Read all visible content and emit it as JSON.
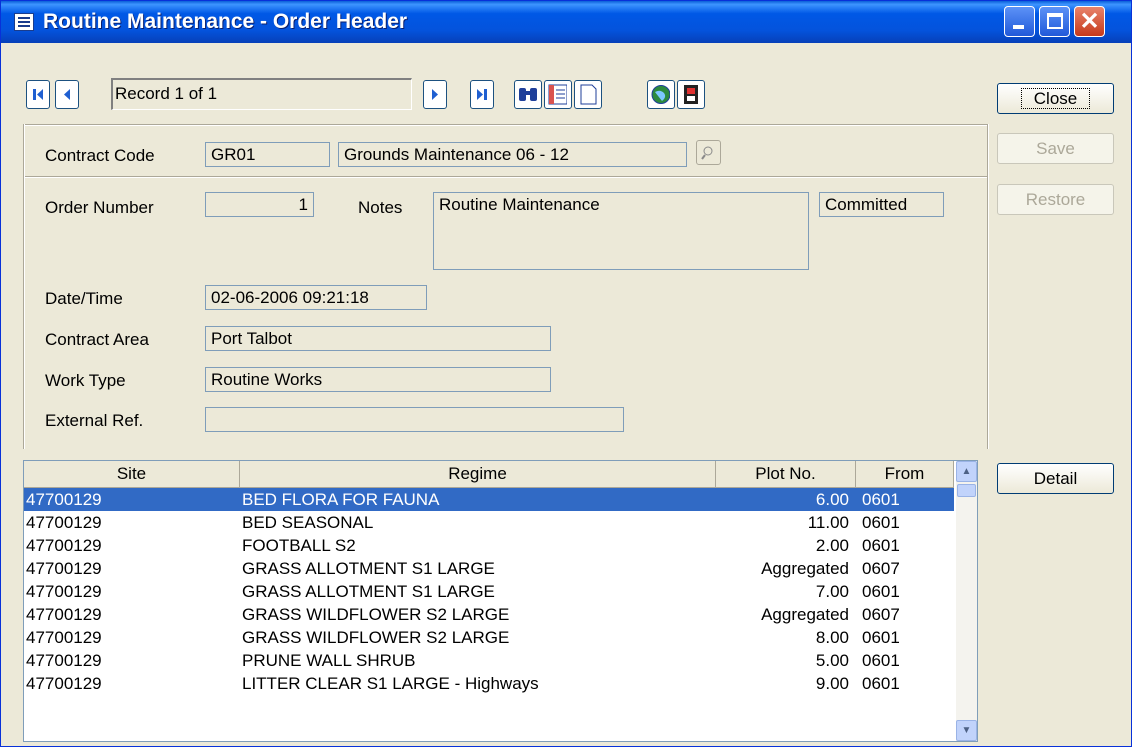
{
  "window": {
    "title": "Routine Maintenance - Order Header",
    "controls": {
      "minimize": "_",
      "maximize": "□",
      "close": "✕"
    }
  },
  "toolbar": {
    "record_label": "Record 1 of 1",
    "icons": [
      "first-record-icon",
      "previous-record-icon",
      "next-record-icon",
      "last-record-icon",
      "binoculars-icon",
      "list-view-icon",
      "blank-page-icon",
      "globe-icon",
      "exit-icon"
    ]
  },
  "side_buttons": {
    "close": "Close",
    "save": "Save",
    "restore": "Restore",
    "detail": "Detail"
  },
  "form": {
    "contract_code_label": "Contract Code",
    "contract_code": "GR01",
    "contract_name": "Grounds Maintenance 06 - 12",
    "order_number_label": "Order Number",
    "order_number": "1",
    "notes_label": "Notes",
    "notes": "Routine Maintenance",
    "status": "Committed",
    "datetime_label": "Date/Time",
    "datetime": "02-06-2006 09:21:18",
    "contract_area_label": "Contract Area",
    "contract_area": "Port Talbot",
    "work_type_label": "Work Type",
    "work_type": "Routine Works",
    "external_ref_label": "External Ref.",
    "external_ref": ""
  },
  "grid": {
    "columns": [
      "Site",
      "Regime",
      "Plot No.",
      "From"
    ],
    "rows": [
      {
        "site": "47700129",
        "regime": "BED FLORA FOR FAUNA",
        "plot": "6.00",
        "from": "0601",
        "selected": true
      },
      {
        "site": "47700129",
        "regime": "BED SEASONAL",
        "plot": "11.00",
        "from": "0601"
      },
      {
        "site": "47700129",
        "regime": "FOOTBALL S2",
        "plot": "2.00",
        "from": "0601"
      },
      {
        "site": "47700129",
        "regime": "GRASS ALLOTMENT S1 LARGE",
        "plot": "Aggregated",
        "from": "0607"
      },
      {
        "site": "47700129",
        "regime": "GRASS ALLOTMENT S1 LARGE",
        "plot": "7.00",
        "from": "0601"
      },
      {
        "site": "47700129",
        "regime": "GRASS WILDFLOWER S2 LARGE",
        "plot": "Aggregated",
        "from": "0607"
      },
      {
        "site": "47700129",
        "regime": "GRASS WILDFLOWER S2 LARGE",
        "plot": "8.00",
        "from": "0601"
      },
      {
        "site": "47700129",
        "regime": "PRUNE WALL SHRUB",
        "plot": "5.00",
        "from": "0601"
      },
      {
        "site": "47700129",
        "regime": "LITTER CLEAR S1 LARGE - Highways",
        "plot": "9.00",
        "from": "0601"
      }
    ]
  },
  "colors": {
    "title_bar": "#0058e6",
    "selection": "#316ac5",
    "dialog_bg": "#ece9d8"
  }
}
